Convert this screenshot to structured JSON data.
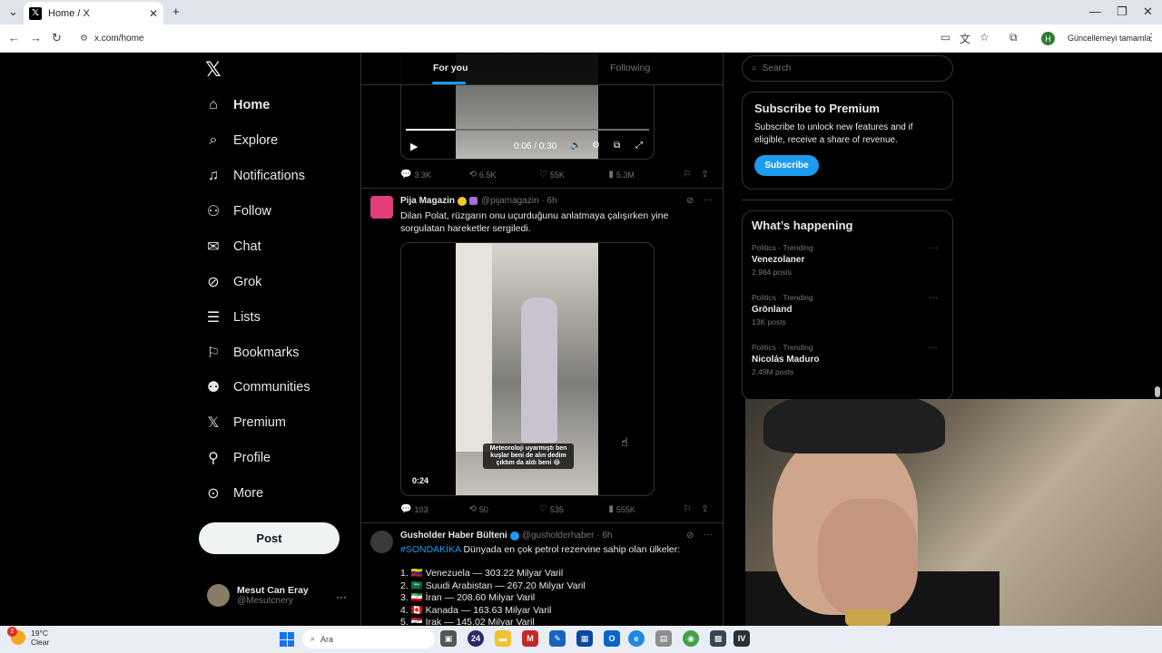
{
  "browser": {
    "tab_title": "Home / X",
    "url": "x.com/home",
    "profile_initial": "H",
    "update_button": "Güncellemeyi tamamla"
  },
  "nav": {
    "items": [
      {
        "label": "Home",
        "icon": "home-icon"
      },
      {
        "label": "Explore",
        "icon": "search-icon"
      },
      {
        "label": "Notifications",
        "icon": "bell-icon"
      },
      {
        "label": "Follow",
        "icon": "follow-icon"
      },
      {
        "label": "Chat",
        "icon": "mail-icon"
      },
      {
        "label": "Grok",
        "icon": "grok-icon"
      },
      {
        "label": "Lists",
        "icon": "lists-icon"
      },
      {
        "label": "Bookmarks",
        "icon": "bookmark-icon"
      },
      {
        "label": "Communities",
        "icon": "communities-icon"
      },
      {
        "label": "Premium",
        "icon": "x-icon"
      },
      {
        "label": "Profile",
        "icon": "person-icon"
      },
      {
        "label": "More",
        "icon": "more-icon"
      }
    ],
    "post_label": "Post",
    "user_name": "Mesut Can Eray",
    "user_handle": "@Mesutcnery"
  },
  "feed": {
    "tabs": [
      "For you",
      "Following"
    ],
    "video1": {
      "time": "0:06 / 0:30",
      "stats": {
        "replies": "3.3K",
        "reposts": "6.5K",
        "likes": "55K",
        "views": "5.3M"
      }
    },
    "tweet2": {
      "name": "Pija Magazin",
      "handle": "@pijamagazin",
      "time": "6h",
      "text": "Dilan Polat, rüzgarın onu uçurduğunu anlatmaya çalışırken yine sorgulatan hareketler sergiledi.",
      "caption": "Meteoroloji uyarmıştı ben kuşlar beni de alın dedim çıktım da aldı beni 😂",
      "duration": "0:24",
      "stats": {
        "replies": "103",
        "reposts": "50",
        "likes": "535",
        "views": "555K"
      }
    },
    "tweet3": {
      "name": "Gusholder Haber Bülteni",
      "handle": "@gusholderhaber",
      "time": "6h",
      "hashtag": "#SONDAKİKA",
      "text": " Dünyada en çok petrol rezervine sahip olan ülkeler:",
      "list": [
        "1. 🇻🇪 Venezuela — 303.22 Milyar Varil",
        "2. 🇸🇦 Suudi Arabistan — 267.20 Milyar Varil",
        "3. 🇮🇷 İran — 208.60 Milyar Varil",
        "4. 🇨🇦 Kanada — 163.63 Milyar Varil",
        "5. 🇮🇶 Irak — 145.02 Milyar Varil"
      ]
    }
  },
  "sidebar": {
    "search_placeholder": "Search",
    "premium": {
      "title": "Subscribe to Premium",
      "text": "Subscribe to unlock new features and if eligible, receive a share of revenue.",
      "button": "Subscribe"
    },
    "happening": {
      "title": "What’s happening",
      "trends": [
        {
          "category": "Politics · Trending",
          "name": "Venezolaner",
          "count": "2,984 posts"
        },
        {
          "category": "Politics · Trending",
          "name": "Grönland",
          "count": "13K posts"
        },
        {
          "category": "Politics · Trending",
          "name": "Nicolás Maduro",
          "count": "2.49M posts"
        }
      ]
    }
  },
  "taskbar": {
    "temp": "19°C",
    "condition": "Clear",
    "badge": "2",
    "search": "Ara"
  },
  "colors": {
    "accent": "#1d9bf0",
    "background": "#000000",
    "border": "#2f3336",
    "muted": "#71767b"
  }
}
